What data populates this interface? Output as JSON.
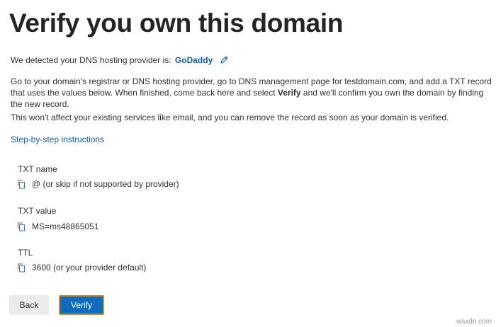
{
  "page": {
    "title": "Verify you own this domain"
  },
  "detected": {
    "prefix": "We detected your DNS hosting provider is:",
    "provider": "GoDaddy",
    "edit_icon": "pencil-icon"
  },
  "instructions": {
    "para1_before_bold": "Go to your domain's registrar or DNS hosting provider, go to DNS management page for testdomain.com, and add a TXT record that uses the values below. When finished, come back here and select ",
    "para1_bold": "Verify",
    "para1_after_bold": " and we'll confirm you own the domain by finding the new record.",
    "para2": "This won't affect your existing services like email, and you can remove the record as soon as your domain is verified."
  },
  "link": {
    "step_by_step": "Step-by-step instructions"
  },
  "record": {
    "name_label": "TXT name",
    "name_value": "@ (or skip if not supported by provider)",
    "value_label": "TXT value",
    "value_value": "MS=ms48865051",
    "ttl_label": "TTL",
    "ttl_value": "3600 (or your provider default)",
    "copy_icon": "copy-icon"
  },
  "buttons": {
    "back": "Back",
    "verify": "Verify"
  },
  "watermark": "wsxdn.com",
  "colors": {
    "link": "#0f5da8",
    "primary_button": "#0f6cbd",
    "focus_border": "#d08a2c",
    "secondary_button": "#edebe9"
  }
}
